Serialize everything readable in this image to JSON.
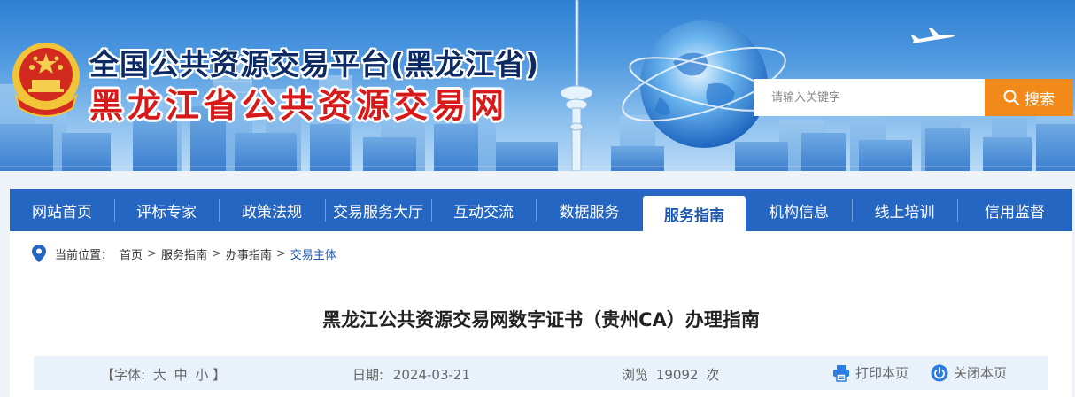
{
  "header": {
    "title_top": "全国公共资源交易平台(黑龙江省)",
    "title_main": "黑龙江省公共资源交易网",
    "search": {
      "placeholder": "请输入关键字",
      "button_label": "搜索"
    },
    "colors": {
      "title_top": "#0d2a63",
      "title_main": "#d61a1a",
      "search_button": "#f28a1a"
    }
  },
  "nav": {
    "items": [
      {
        "label": "网站首页",
        "active": false
      },
      {
        "label": "评标专家",
        "active": false
      },
      {
        "label": "政策法规",
        "active": false
      },
      {
        "label": "交易服务大厅",
        "active": false
      },
      {
        "label": "互动交流",
        "active": false
      },
      {
        "label": "数据服务",
        "active": false
      },
      {
        "label": "服务指南",
        "active": true
      },
      {
        "label": "机构信息",
        "active": false
      },
      {
        "label": "线上培训",
        "active": false
      },
      {
        "label": "信用监督",
        "active": false
      }
    ],
    "colors": {
      "background": "#2566c2",
      "active_text": "#1c57b0"
    }
  },
  "breadcrumb": {
    "label": "当前位置：",
    "items": [
      "首页",
      "服务指南",
      "办事指南",
      "交易主体"
    ],
    "separator": ">"
  },
  "article": {
    "title": "黑龙江公共资源交易网数字证书（贵州CA）办理指南",
    "font_size_label": "【字体:",
    "font_large": "大",
    "font_medium": "中",
    "font_small": "小",
    "font_size_end": "】",
    "date_label": "日期:",
    "date": "2024-03-21",
    "views_label": "浏览",
    "views": "19092",
    "views_unit": "次",
    "print_label": "打印本页",
    "close_label": "关闭本页"
  }
}
